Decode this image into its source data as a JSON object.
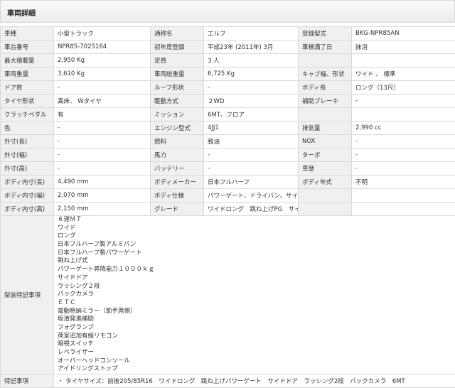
{
  "section_title": "車両詳細",
  "rows": [
    [
      [
        "車種",
        "小型トラック"
      ],
      [
        "通称名",
        "エルフ"
      ],
      [
        "登録型式",
        "BKG-NPR85AN"
      ]
    ],
    [
      [
        "車台番号",
        "NPR85-7025164"
      ],
      [
        "初年度登録",
        "平成23年 (2011年) 3月"
      ],
      [
        "車検満了日",
        "抹消"
      ]
    ],
    [
      [
        "最大積載量",
        "2,950 Kg"
      ],
      [
        "定員",
        "3 人"
      ],
      [
        "",
        ""
      ]
    ],
    [
      [
        "車両重量",
        "3,610 Kg"
      ],
      [
        "車両総重量",
        "6,725 Kg"
      ],
      [
        "キャブ幅、形状",
        "ワイド 、 標準"
      ]
    ],
    [
      [
        "ドア数",
        "-"
      ],
      [
        "ルーフ形状",
        "-"
      ],
      [
        "ボディ長",
        "ロング（13尺）"
      ]
    ],
    [
      [
        "タイヤ形状",
        "高床、 Wタイヤ"
      ],
      [
        "駆動方式",
        "２WD"
      ],
      [
        "補助ブレーキ",
        "-"
      ]
    ],
    [
      [
        "クラッチペダル",
        "有"
      ],
      [
        "ミッション",
        "6MT、フロア"
      ],
      [
        "",
        ""
      ]
    ],
    [
      [
        "色",
        "-"
      ],
      [
        "エンジン型式",
        "4JJ1"
      ],
      [
        "排気量",
        "2,990 cc"
      ]
    ],
    [
      [
        "外寸(長)",
        "-"
      ],
      [
        "燃料",
        "軽油"
      ],
      [
        "NOX",
        "-"
      ]
    ],
    [
      [
        "外寸(幅)",
        "-"
      ],
      [
        "馬力",
        "-"
      ],
      [
        "ターボ",
        "-"
      ]
    ],
    [
      [
        "外寸(高)",
        "-"
      ],
      [
        "バッテリー",
        "-"
      ],
      [
        "車歴",
        "-"
      ]
    ],
    [
      [
        "ボディ内寸(長)",
        "4,490 mm"
      ],
      [
        "ボディメーカー",
        "日本フルハーフ"
      ],
      [
        "ボディ年式",
        "不明"
      ]
    ],
    [
      [
        "ボディ内寸(幅)",
        "2,070 mm"
      ],
      [
        "ボディ仕様",
        "パワーゲート、ドライバン、サイドドア（助）"
      ],
      [
        "",
        ""
      ]
    ],
    [
      [
        "ボディ内寸(高)",
        "2,150 mm"
      ],
      [
        "グレード",
        "ワイドロング　跳ね上げPG　サイドドア"
      ],
      [
        "",
        ""
      ]
    ]
  ],
  "equipment": {
    "label": "架装特記事項",
    "items": [
      "６速ＭＴ",
      "ワイド",
      "ロング",
      "日本フルハーフ製アルミバン",
      "日本フルハーフ製パワーゲート",
      "跳ね上げ式",
      "パワーゲート昇降能力１０００ｋｇ",
      "サイドドア",
      "ラッシング２段",
      "バックカメラ",
      "ＥＴＣ",
      "電動格納ミラー（助手席側）",
      "坂道発進補助",
      "フォグランプ",
      "荷室追加有線リモコン",
      "暗視スイッチ",
      "レベライザー",
      "オーバーヘッドコンソール",
      "アイドリングストップ"
    ]
  },
  "notes": {
    "label": "特記事項",
    "bullet": "・",
    "text": "タイヤサイズ：前後205/85R16　ワイドロング　跳ね上げパワーゲート　サイドドア　ラッシング2段　バックカメラ　6MT"
  }
}
